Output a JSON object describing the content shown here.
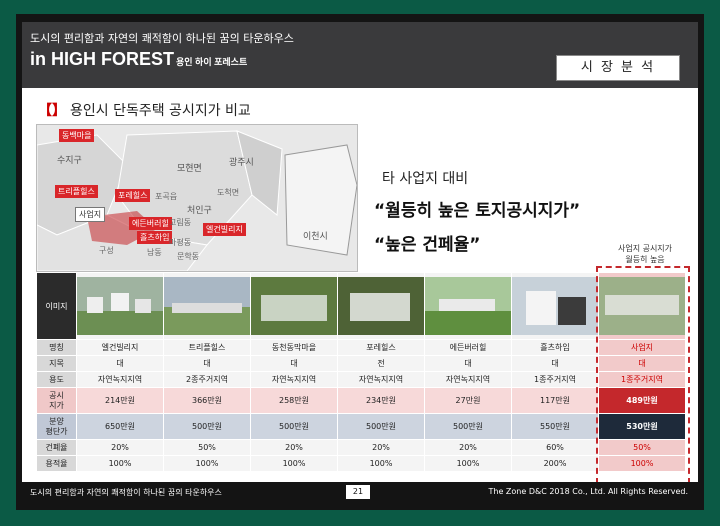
{
  "header": {
    "subtitle": "도시의 편리함과 자연의 쾌적함이 하나된 꿈의 타운하우스",
    "title": "in HIGH FOREST",
    "title_small": "용인 하이 포레스트",
    "tag": "시 장 분 석"
  },
  "section": {
    "bracket": "【】",
    "title": "용인시 단독주택 공시지가 비교"
  },
  "map": {
    "labels": [
      {
        "text": "동백마을",
        "style": "red"
      },
      {
        "text": "트리플힐스",
        "style": "red"
      },
      {
        "text": "포레힐스",
        "style": "red"
      },
      {
        "text": "사업지",
        "style": "white"
      },
      {
        "text": "에든버러힐",
        "style": "red"
      },
      {
        "text": "흘츠하임",
        "style": "red"
      },
      {
        "text": "엘건빌리지",
        "style": "red"
      }
    ],
    "regions": [
      "수지구",
      "모현면",
      "광주시",
      "포곡읍",
      "처인구",
      "도척면",
      "고림동",
      "마평동",
      "문학동",
      "남동",
      "구성",
      "이천시"
    ]
  },
  "comparison": {
    "line1": "타 사업지 대비",
    "line2": "“월등히 높은 토지공시지가”",
    "line3": "“높은 건페율”"
  },
  "note": {
    "line1": "사업지 공시지가",
    "line2": "월등히 높음"
  },
  "table": {
    "row_labels": [
      "이미지",
      "명칭",
      "지목",
      "용도",
      "공시\n지가",
      "분양\n평단가",
      "건폐율",
      "용적율"
    ],
    "columns": [
      {
        "name": "엘건빌리지",
        "jimok": "대",
        "use": "자연녹지지역",
        "land_price": "214만원",
        "sale_price": "650만원",
        "bcr": "20%",
        "far": "100%"
      },
      {
        "name": "트리플힐스",
        "jimok": "대",
        "use": "2종주거지역",
        "land_price": "366만원",
        "sale_price": "500만원",
        "bcr": "50%",
        "far": "100%"
      },
      {
        "name": "동천동막마을",
        "jimok": "대",
        "use": "자연녹지지역",
        "land_price": "258만원",
        "sale_price": "500만원",
        "bcr": "20%",
        "far": "100%"
      },
      {
        "name": "포레힐스",
        "jimok": "전",
        "use": "자연녹지지역",
        "land_price": "234만원",
        "sale_price": "500만원",
        "bcr": "20%",
        "far": "100%"
      },
      {
        "name": "에든버러힐",
        "jimok": "대",
        "use": "자연녹지지역",
        "land_price": "27만원",
        "sale_price": "500만원",
        "bcr": "20%",
        "far": "100%"
      },
      {
        "name": "흘츠하임",
        "jimok": "대",
        "use": "1종주거지역",
        "land_price": "117만원",
        "sale_price": "550만원",
        "bcr": "60%",
        "far": "200%"
      },
      {
        "name": "사업지",
        "jimok": "대",
        "use": "1종주거지역",
        "land_price": "489만원",
        "sale_price": "530만원",
        "bcr": "50%",
        "far": "100%"
      }
    ]
  },
  "footer": {
    "left": "도시의 편리함과 자연의 쾌적함이 하나된 꿈의 타운하우스",
    "page": "21",
    "right": "The Zone D&C 2018 Co., Ltd. All Rights Reserved."
  },
  "colors": {
    "accent_red": "#c4282c",
    "header_bg": "#3a3a3c",
    "frame_green": "#0b5a45"
  }
}
